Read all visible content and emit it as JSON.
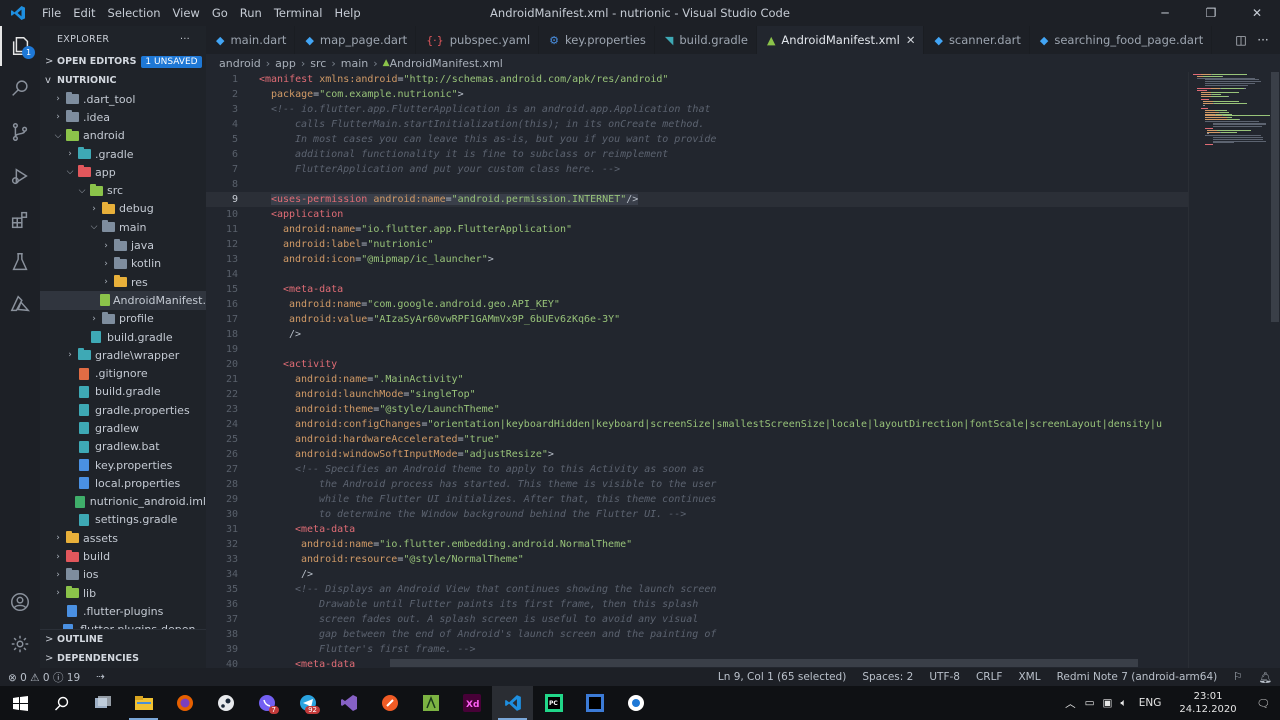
{
  "window": {
    "title": "AndroidManifest.xml - nutrionic - Visual Studio Code",
    "menus": [
      "File",
      "Edit",
      "Selection",
      "View",
      "Go",
      "Run",
      "Terminal",
      "Help"
    ]
  },
  "sidebar": {
    "title": "EXPLORER",
    "more": "···",
    "open_editors": "OPEN EDITORS",
    "unsaved_badge": "1 UNSAVED",
    "project": "NUTRIONIC",
    "tree": [
      {
        "label": ".dart_tool",
        "depth": 1,
        "chev": ">",
        "kind": "folder",
        "color": "#7e8d9e"
      },
      {
        "label": ".idea",
        "depth": 1,
        "chev": ">",
        "kind": "folder",
        "color": "#7e8d9e"
      },
      {
        "label": "android",
        "depth": 1,
        "chev": "v",
        "kind": "folder",
        "color": "#8bc34a"
      },
      {
        "label": ".gradle",
        "depth": 2,
        "chev": ">",
        "kind": "folder",
        "color": "#3ea9b5"
      },
      {
        "label": "app",
        "depth": 2,
        "chev": "v",
        "kind": "folder",
        "color": "#e2575c"
      },
      {
        "label": "src",
        "depth": 3,
        "chev": "v",
        "kind": "folder",
        "color": "#8bc34a"
      },
      {
        "label": "debug",
        "depth": 4,
        "chev": ">",
        "kind": "folder",
        "color": "#e8b03a"
      },
      {
        "label": "main",
        "depth": 4,
        "chev": "v",
        "kind": "folder",
        "color": "#7e8d9e"
      },
      {
        "label": "java",
        "depth": 5,
        "chev": ">",
        "kind": "folder",
        "color": "#7e8d9e"
      },
      {
        "label": "kotlin",
        "depth": 5,
        "chev": ">",
        "kind": "folder",
        "color": "#7e8d9e"
      },
      {
        "label": "res",
        "depth": 5,
        "chev": ">",
        "kind": "folder",
        "color": "#e8b03a"
      },
      {
        "label": "AndroidManifest....",
        "depth": 5,
        "chev": "",
        "kind": "file",
        "color": "#8bc34a",
        "selected": true
      },
      {
        "label": "profile",
        "depth": 4,
        "chev": ">",
        "kind": "folder",
        "color": "#7e8d9e"
      },
      {
        "label": "build.gradle",
        "depth": 3,
        "chev": "",
        "kind": "file",
        "color": "#3ea9b5"
      },
      {
        "label": "gradle\\wrapper",
        "depth": 2,
        "chev": ">",
        "kind": "folder",
        "color": "#3ea9b5"
      },
      {
        "label": ".gitignore",
        "depth": 2,
        "chev": "",
        "kind": "file",
        "color": "#e06c44"
      },
      {
        "label": "build.gradle",
        "depth": 2,
        "chev": "",
        "kind": "file",
        "color": "#3ea9b5"
      },
      {
        "label": "gradle.properties",
        "depth": 2,
        "chev": "",
        "kind": "file",
        "color": "#3ea9b5"
      },
      {
        "label": "gradlew",
        "depth": 2,
        "chev": "",
        "kind": "file",
        "color": "#3ea9b5"
      },
      {
        "label": "gradlew.bat",
        "depth": 2,
        "chev": "",
        "kind": "file",
        "color": "#3ea9b5"
      },
      {
        "label": "key.properties",
        "depth": 2,
        "chev": "",
        "kind": "file",
        "color": "#4a90e2"
      },
      {
        "label": "local.properties",
        "depth": 2,
        "chev": "",
        "kind": "file",
        "color": "#4a90e2"
      },
      {
        "label": "nutrionic_android.iml",
        "depth": 2,
        "chev": "",
        "kind": "file",
        "color": "#3fae6a"
      },
      {
        "label": "settings.gradle",
        "depth": 2,
        "chev": "",
        "kind": "file",
        "color": "#3ea9b5"
      },
      {
        "label": "assets",
        "depth": 1,
        "chev": ">",
        "kind": "folder",
        "color": "#e8b03a"
      },
      {
        "label": "build",
        "depth": 1,
        "chev": ">",
        "kind": "folder",
        "color": "#e2575c"
      },
      {
        "label": "ios",
        "depth": 1,
        "chev": ">",
        "kind": "folder",
        "color": "#7e8d9e"
      },
      {
        "label": "lib",
        "depth": 1,
        "chev": ">",
        "kind": "folder",
        "color": "#8bc34a"
      },
      {
        "label": ".flutter-plugins",
        "depth": 1,
        "chev": "",
        "kind": "file",
        "color": "#4a90e2"
      },
      {
        "label": ".flutter-plugins-depen...",
        "depth": 1,
        "chev": "",
        "kind": "file",
        "color": "#4a90e2"
      }
    ],
    "outline": "OUTLINE",
    "dependencies": "DEPENDENCIES"
  },
  "tabs": [
    {
      "label": "main.dart",
      "icon": "◆",
      "color": "#42a5f5",
      "active": false
    },
    {
      "label": "map_page.dart",
      "icon": "◆",
      "color": "#42a5f5",
      "active": false
    },
    {
      "label": "pubspec.yaml",
      "icon": "{·}",
      "color": "#e2575c",
      "active": false
    },
    {
      "label": "key.properties",
      "icon": "⚙",
      "color": "#4a90e2",
      "active": false
    },
    {
      "label": "build.gradle",
      "icon": "◥",
      "color": "#3ea9b5",
      "active": false
    },
    {
      "label": "AndroidManifest.xml",
      "icon": "▲",
      "color": "#8bc34a",
      "active": true,
      "close": "✕"
    },
    {
      "label": "scanner.dart",
      "icon": "◆",
      "color": "#42a5f5",
      "active": false
    },
    {
      "label": "searching_food_page.dart",
      "icon": "◆",
      "color": "#42a5f5",
      "active": false
    }
  ],
  "breadcrumb": [
    "android",
    "app",
    "src",
    "main",
    "AndroidManifest.xml"
  ],
  "code": [
    {
      "n": "1",
      "i": 0,
      "t": [
        [
          "tg",
          "<manifest "
        ],
        [
          "at",
          "xmlns:android"
        ],
        [
          "pn",
          "="
        ],
        [
          "st",
          "\"http://schemas.android.com/apk/res/android\""
        ]
      ]
    },
    {
      "n": "2",
      "i": 2,
      "t": [
        [
          "at",
          "package"
        ],
        [
          "pn",
          "="
        ],
        [
          "st",
          "\"com.example.nutrionic\""
        ],
        [
          "pn",
          ">"
        ]
      ]
    },
    {
      "n": "3",
      "i": 2,
      "t": [
        [
          "cm",
          "<!-- io.flutter.app.FlutterApplication is an android.app.Application that"
        ]
      ]
    },
    {
      "n": "4",
      "i": 6,
      "t": [
        [
          "cm",
          "calls FlutterMain.startInitialization(this); in its onCreate method."
        ]
      ]
    },
    {
      "n": "5",
      "i": 6,
      "t": [
        [
          "cm",
          "In most cases you can leave this as-is, but you if you want to provide"
        ]
      ]
    },
    {
      "n": "6",
      "i": 6,
      "t": [
        [
          "cm",
          "additional functionality it is fine to subclass or reimplement"
        ]
      ]
    },
    {
      "n": "7",
      "i": 6,
      "t": [
        [
          "cm",
          "FlutterApplication and put your custom class here. -->"
        ]
      ]
    },
    {
      "n": "8",
      "i": 0,
      "t": []
    },
    {
      "n": "9",
      "i": 2,
      "cur": true,
      "t": [
        [
          "tg",
          "<uses-permission "
        ],
        [
          "at",
          "android:name"
        ],
        [
          "pn",
          "="
        ],
        [
          "st",
          "\"android.permission.INTERNET\""
        ],
        [
          "pn",
          "/>"
        ]
      ]
    },
    {
      "n": "10",
      "i": 2,
      "t": [
        [
          "tg",
          "<application"
        ]
      ]
    },
    {
      "n": "11",
      "i": 4,
      "t": [
        [
          "at",
          "android:name"
        ],
        [
          "pn",
          "="
        ],
        [
          "st",
          "\"io.flutter.app.FlutterApplication\""
        ]
      ]
    },
    {
      "n": "12",
      "i": 4,
      "t": [
        [
          "at",
          "android:label"
        ],
        [
          "pn",
          "="
        ],
        [
          "st",
          "\"nutrionic\""
        ]
      ]
    },
    {
      "n": "13",
      "i": 4,
      "t": [
        [
          "at",
          "android:icon"
        ],
        [
          "pn",
          "="
        ],
        [
          "st",
          "\"@mipmap/ic_launcher\""
        ],
        [
          "pn",
          ">"
        ]
      ]
    },
    {
      "n": "14",
      "i": 0,
      "t": []
    },
    {
      "n": "15",
      "i": 4,
      "t": [
        [
          "tg",
          "<meta-data"
        ]
      ]
    },
    {
      "n": "16",
      "i": 5,
      "t": [
        [
          "at",
          "android:name"
        ],
        [
          "pn",
          "="
        ],
        [
          "st",
          "\"com.google.android.geo.API_KEY\""
        ]
      ]
    },
    {
      "n": "17",
      "i": 5,
      "t": [
        [
          "at",
          "android:value"
        ],
        [
          "pn",
          "="
        ],
        [
          "st",
          "\"AIzaSyAr60vwRPF1GAMmVx9P_6bUEv6zKq6e-3Y\""
        ]
      ]
    },
    {
      "n": "18",
      "i": 5,
      "t": [
        [
          "pn",
          "/>"
        ]
      ]
    },
    {
      "n": "19",
      "i": 0,
      "t": []
    },
    {
      "n": "20",
      "i": 4,
      "t": [
        [
          "tg",
          "<activity"
        ]
      ]
    },
    {
      "n": "21",
      "i": 6,
      "t": [
        [
          "at",
          "android:name"
        ],
        [
          "pn",
          "="
        ],
        [
          "st",
          "\".MainActivity\""
        ]
      ]
    },
    {
      "n": "22",
      "i": 6,
      "t": [
        [
          "at",
          "android:launchMode"
        ],
        [
          "pn",
          "="
        ],
        [
          "st",
          "\"singleTop\""
        ]
      ]
    },
    {
      "n": "23",
      "i": 6,
      "t": [
        [
          "at",
          "android:theme"
        ],
        [
          "pn",
          "="
        ],
        [
          "st",
          "\"@style/LaunchTheme\""
        ]
      ]
    },
    {
      "n": "24",
      "i": 6,
      "t": [
        [
          "at",
          "android:configChanges"
        ],
        [
          "pn",
          "="
        ],
        [
          "st",
          "\"orientation|keyboardHidden|keyboard|screenSize|smallestScreenSize|locale|layoutDirection|fontScale|screenLayout|density|u"
        ]
      ]
    },
    {
      "n": "25",
      "i": 6,
      "t": [
        [
          "at",
          "android:hardwareAccelerated"
        ],
        [
          "pn",
          "="
        ],
        [
          "st",
          "\"true\""
        ]
      ]
    },
    {
      "n": "26",
      "i": 6,
      "t": [
        [
          "at",
          "android:windowSoftInputMode"
        ],
        [
          "pn",
          "="
        ],
        [
          "st",
          "\"adjustResize\""
        ],
        [
          "pn",
          ">"
        ]
      ]
    },
    {
      "n": "27",
      "i": 6,
      "t": [
        [
          "cm",
          "<!-- Specifies an Android theme to apply to this Activity as soon as"
        ]
      ]
    },
    {
      "n": "28",
      "i": 10,
      "t": [
        [
          "cm",
          "the Android process has started. This theme is visible to the user"
        ]
      ]
    },
    {
      "n": "29",
      "i": 10,
      "t": [
        [
          "cm",
          "while the Flutter UI initializes. After that, this theme continues"
        ]
      ]
    },
    {
      "n": "30",
      "i": 10,
      "t": [
        [
          "cm",
          "to determine the Window background behind the Flutter UI. -->"
        ]
      ]
    },
    {
      "n": "31",
      "i": 6,
      "t": [
        [
          "tg",
          "<meta-data"
        ]
      ]
    },
    {
      "n": "32",
      "i": 7,
      "t": [
        [
          "at",
          "android:name"
        ],
        [
          "pn",
          "="
        ],
        [
          "st",
          "\"io.flutter.embedding.android.NormalTheme\""
        ]
      ]
    },
    {
      "n": "33",
      "i": 7,
      "t": [
        [
          "at",
          "android:resource"
        ],
        [
          "pn",
          "="
        ],
        [
          "st",
          "\"@style/NormalTheme\""
        ]
      ]
    },
    {
      "n": "34",
      "i": 7,
      "t": [
        [
          "pn",
          "/>"
        ]
      ]
    },
    {
      "n": "35",
      "i": 6,
      "t": [
        [
          "cm",
          "<!-- Displays an Android View that continues showing the launch screen"
        ]
      ]
    },
    {
      "n": "36",
      "i": 10,
      "t": [
        [
          "cm",
          "Drawable until Flutter paints its first frame, then this splash"
        ]
      ]
    },
    {
      "n": "37",
      "i": 10,
      "t": [
        [
          "cm",
          "screen fades out. A splash screen is useful to avoid any visual"
        ]
      ]
    },
    {
      "n": "38",
      "i": 10,
      "t": [
        [
          "cm",
          "gap between the end of Android's launch screen and the painting of"
        ]
      ]
    },
    {
      "n": "39",
      "i": 10,
      "t": [
        [
          "cm",
          "Flutter's first frame. -->"
        ]
      ]
    },
    {
      "n": "40",
      "i": 6,
      "t": [
        [
          "tg",
          "<meta-data"
        ]
      ]
    }
  ],
  "status": {
    "errors": "0",
    "warnings": "0",
    "info": "19",
    "position": "Ln 9, Col 1 (65 selected)",
    "spaces": "Spaces: 2",
    "encoding": "UTF-8",
    "eol": "CRLF",
    "language": "XML",
    "device": "Redmi Note 7 (android-arm64)"
  },
  "taskbar": {
    "lang": "ENG",
    "time": "23:01",
    "date": "24.12.2020",
    "badge_viber": "7",
    "badge_telegram": "92"
  },
  "colors": {
    "accent": "#1e78d6",
    "tag": "#e06c75",
    "attr": "#d19a66",
    "string": "#98c379",
    "comment": "#5c6370"
  }
}
